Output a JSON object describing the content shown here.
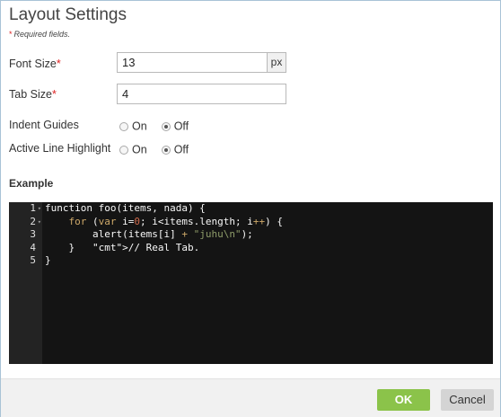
{
  "dialog": {
    "title": "Layout Settings",
    "required_note": "Required fields.",
    "required_star": "*"
  },
  "fields": {
    "font_size": {
      "label": "Font Size",
      "value": "13",
      "unit": "px"
    },
    "tab_size": {
      "label": "Tab Size",
      "value": "4"
    },
    "indent_guides": {
      "label": "Indent Guides",
      "options": [
        "On",
        "Off"
      ],
      "selected": "Off"
    },
    "active_line": {
      "label": "Active Line Highlight",
      "options": [
        "On",
        "Off"
      ],
      "selected": "Off"
    }
  },
  "example": {
    "heading": "Example",
    "line_numbers": [
      "1",
      "2",
      "3",
      "4",
      "5"
    ],
    "code_lines": [
      "function foo(items, nada) {",
      "    for (var i=0; i<items.length; i++) {",
      "        alert(items[i] + \"juhu\\n\");",
      "    }   // Real Tab.",
      "}"
    ]
  },
  "footer": {
    "ok_label": "OK",
    "cancel_label": "Cancel"
  },
  "colors": {
    "ok_button": "#8bc34a",
    "cancel_button": "#d4d4d4",
    "editor_bg": "#141414",
    "keyword": "#cda869",
    "number": "#cf6a4c",
    "string": "#8f9d6a",
    "comment": "#5f5a60"
  }
}
